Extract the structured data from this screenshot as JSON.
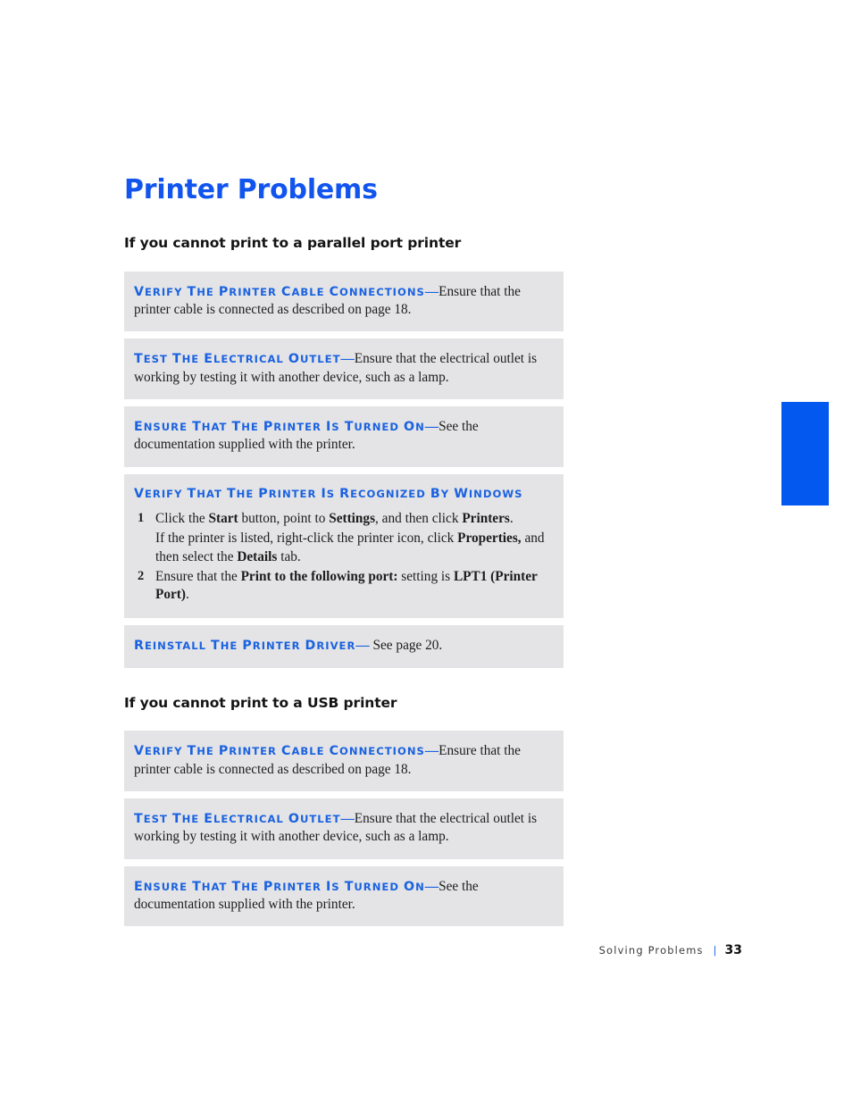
{
  "document": {
    "title": "Printer Problems",
    "title_color": "#1155ee",
    "box_background": "#e4e4e6",
    "heading_color": "#1a62e0",
    "tab_color": "#0359ef"
  },
  "sections": [
    {
      "heading": "If you cannot print to a parallel port printer",
      "tips": [
        {
          "head": "Verify the printer cable connections",
          "dash": "—",
          "body": "Ensure that the printer cable is connected as described on page 18."
        },
        {
          "head": "Test the electrical outlet",
          "dash": "—",
          "body": "Ensure that the electrical outlet is working by testing it with another device, such as a lamp."
        },
        {
          "head": "Ensure that the printer is turned on",
          "dash": "—",
          "body": "See the documentation supplied with the printer."
        }
      ],
      "steps_box": {
        "head": "Verify that the printer is recognized by Windows",
        "steps": [
          {
            "num": "1",
            "part1": "Click the ",
            "bold1": "Start",
            "part2": " button, point to ",
            "bold2": "Settings",
            "part3": ", and then click ",
            "bold3": "Printers",
            "part4": ".",
            "sub_part1": "If the printer is listed, right-click the printer icon, click ",
            "sub_bold1": "Properties,",
            "sub_part2": " and then select the ",
            "sub_bold2": "Details",
            "sub_part3": " tab."
          },
          {
            "num": "2",
            "part1": "Ensure that the ",
            "bold1": "Print to the following port:",
            "part2": " setting is ",
            "bold2": "LPT1 (Printer Port)",
            "part3": "."
          }
        ]
      },
      "tips_after": [
        {
          "head": "Reinstall the printer driver",
          "dash": "—",
          "body": " See page 20."
        }
      ]
    },
    {
      "heading": "If you cannot print to a USB printer",
      "tips": [
        {
          "head": "Verify the printer cable connections",
          "dash": "—",
          "body": "Ensure that the printer cable is connected as described on page 18."
        },
        {
          "head": "Test the electrical outlet",
          "dash": "—",
          "body": "Ensure that the electrical outlet is working by testing it with another device, such as a lamp."
        },
        {
          "head": "Ensure that the printer is turned on",
          "dash": "—",
          "body": "See the documentation supplied with the printer."
        }
      ]
    }
  ],
  "footer": {
    "chapter": "Solving Problems",
    "separator": "|",
    "page_number": "33"
  }
}
